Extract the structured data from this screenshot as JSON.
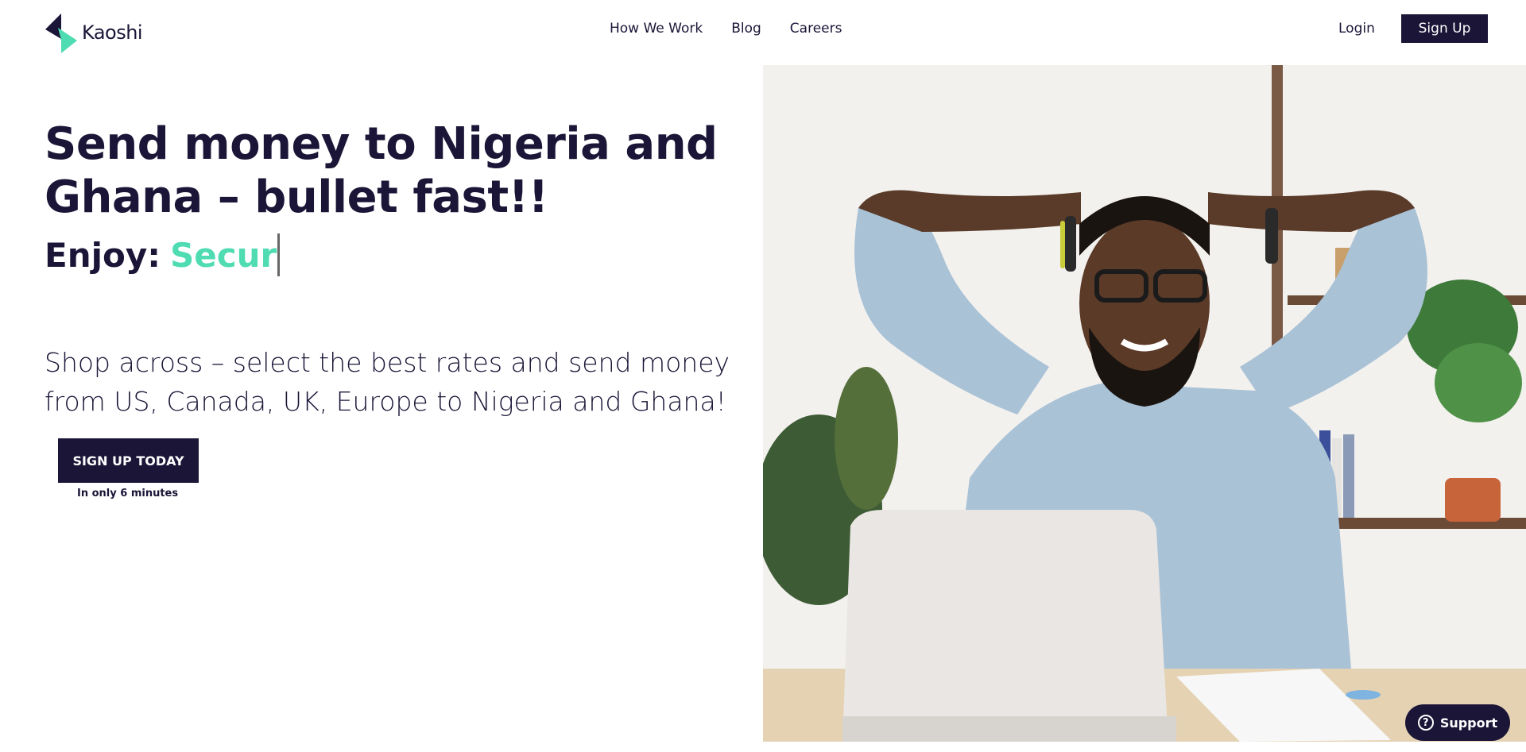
{
  "brand": {
    "name": "Kaoshi",
    "accent": "#4fdcb2",
    "primary": "#1b1537"
  },
  "nav": {
    "items": [
      "How We Work",
      "Blog",
      "Careers"
    ]
  },
  "auth": {
    "login": "Login",
    "signup": "Sign Up"
  },
  "hero": {
    "title": "Send money to Nigeria and Ghana – bullet fast!!",
    "enjoy_label": "Enjoy:",
    "enjoy_word": "Secur",
    "subtitle": "Shop across – select the best rates and send money from US, Canada, UK, Europe to Nigeria and Ghana!",
    "cta": "SIGN UP TODAY",
    "cta_note": "In only 6 minutes",
    "image_icon": "hero-photo"
  },
  "support": {
    "label": "Support",
    "icon": "question-icon",
    "glyph": "?"
  }
}
